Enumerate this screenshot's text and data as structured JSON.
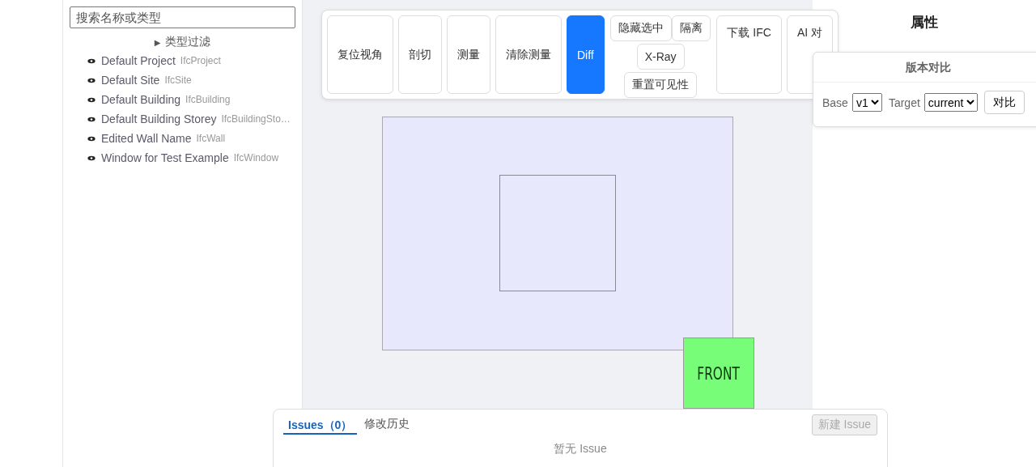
{
  "sidebar": {
    "search": {
      "placeholder": "搜索名称或类型"
    },
    "filter": {
      "icon": "▶",
      "label": "类型过滤",
      "expanded": false
    },
    "tree": [
      {
        "name": "Default Project",
        "type": "IfcProject",
        "visible": true
      },
      {
        "name": "Default Site",
        "type": "IfcSite",
        "visible": true
      },
      {
        "name": "Default Building",
        "type": "IfcBuilding",
        "visible": true
      },
      {
        "name": "Default Building Storey",
        "type": "IfcBuildingSto…",
        "visible": true
      },
      {
        "name": "Edited Wall Name",
        "type": "IfcWall",
        "visible": true
      },
      {
        "name": "Window for Test Example",
        "type": "IfcWindow",
        "visible": true
      }
    ]
  },
  "toolbar": {
    "buttons": [
      {
        "label": "复位视角",
        "active": false
      },
      {
        "label": "剖切",
        "active": false
      },
      {
        "label": "测量",
        "active": false
      },
      {
        "label": "清除测量",
        "active": false
      },
      {
        "label": "Diff",
        "active": true
      }
    ],
    "visibility_buttons": [
      "隐藏选中",
      "隔离",
      "X-Ray",
      "重置可见性"
    ],
    "buttons_after": [
      "下载 IFC",
      "AI 对"
    ]
  },
  "viewport": {
    "view_cube": "FRONT"
  },
  "properties": {
    "title": "属性"
  },
  "diff_popup": {
    "title": "版本对比",
    "base_label": "Base",
    "base_value": "v1",
    "target_label": "Target",
    "target_value": "current",
    "button": "对比"
  },
  "issues_panel": {
    "tabs": [
      {
        "label": "Issues（0）",
        "selected": true
      },
      {
        "label": "修改历史",
        "selected": false
      }
    ],
    "new_button": {
      "label": "新建 Issue",
      "disabled": true
    },
    "empty_text": "暂无 Issue"
  }
}
